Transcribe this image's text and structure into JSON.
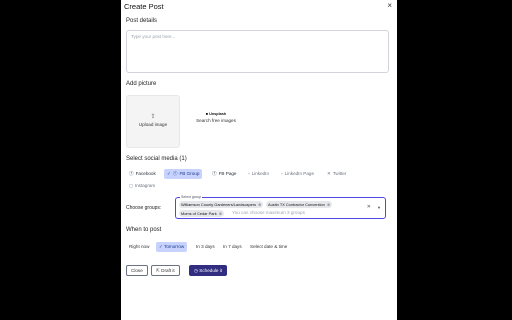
{
  "dialog": {
    "title": "Create Post",
    "close_icon": "×"
  },
  "post_details": {
    "label": "Post details",
    "placeholder": "Type your post here..."
  },
  "picture": {
    "label": "Add picture",
    "upload_label": "Upload image",
    "unsplash_logo": "Unsplash",
    "search_label": "Search free images"
  },
  "social": {
    "label": "Select social media (1)",
    "items": [
      {
        "label": "Facebook",
        "icon": "facebook-icon",
        "selected": false
      },
      {
        "label": "FB Group",
        "icon": "check-icon",
        "selected": true
      },
      {
        "label": "FB Page",
        "icon": "facebook-icon",
        "selected": false
      },
      {
        "label": "LinkedIn",
        "icon": "linkedin-icon",
        "selected": false
      },
      {
        "label": "LinkedIn Page",
        "icon": "linkedin-icon",
        "selected": false
      },
      {
        "label": "Twitter",
        "icon": "twitter-icon",
        "selected": false
      },
      {
        "label": "Instagram",
        "icon": "instagram-icon",
        "selected": false
      }
    ]
  },
  "groups": {
    "label": "Choose groups:",
    "legend": "Select group",
    "selected": [
      "Williamson County Gardeners/Landscapers",
      "Austin TX Contractor Convention",
      "Moms of Cedar Park"
    ],
    "placeholder": "You can choose maximum 3 groups"
  },
  "when": {
    "label": "When to post",
    "options": [
      "Right now",
      "Tomorrow",
      "In 3 days",
      "In 7 days",
      "Select date & time"
    ],
    "selected": "Tomorrow"
  },
  "actions": {
    "close": "Close",
    "draft": "Draft it",
    "schedule": "Schedule it"
  },
  "colors": {
    "accent": "#312e81",
    "selected_chip": "#c7d2fe",
    "focus_border": "#4f46e5"
  }
}
